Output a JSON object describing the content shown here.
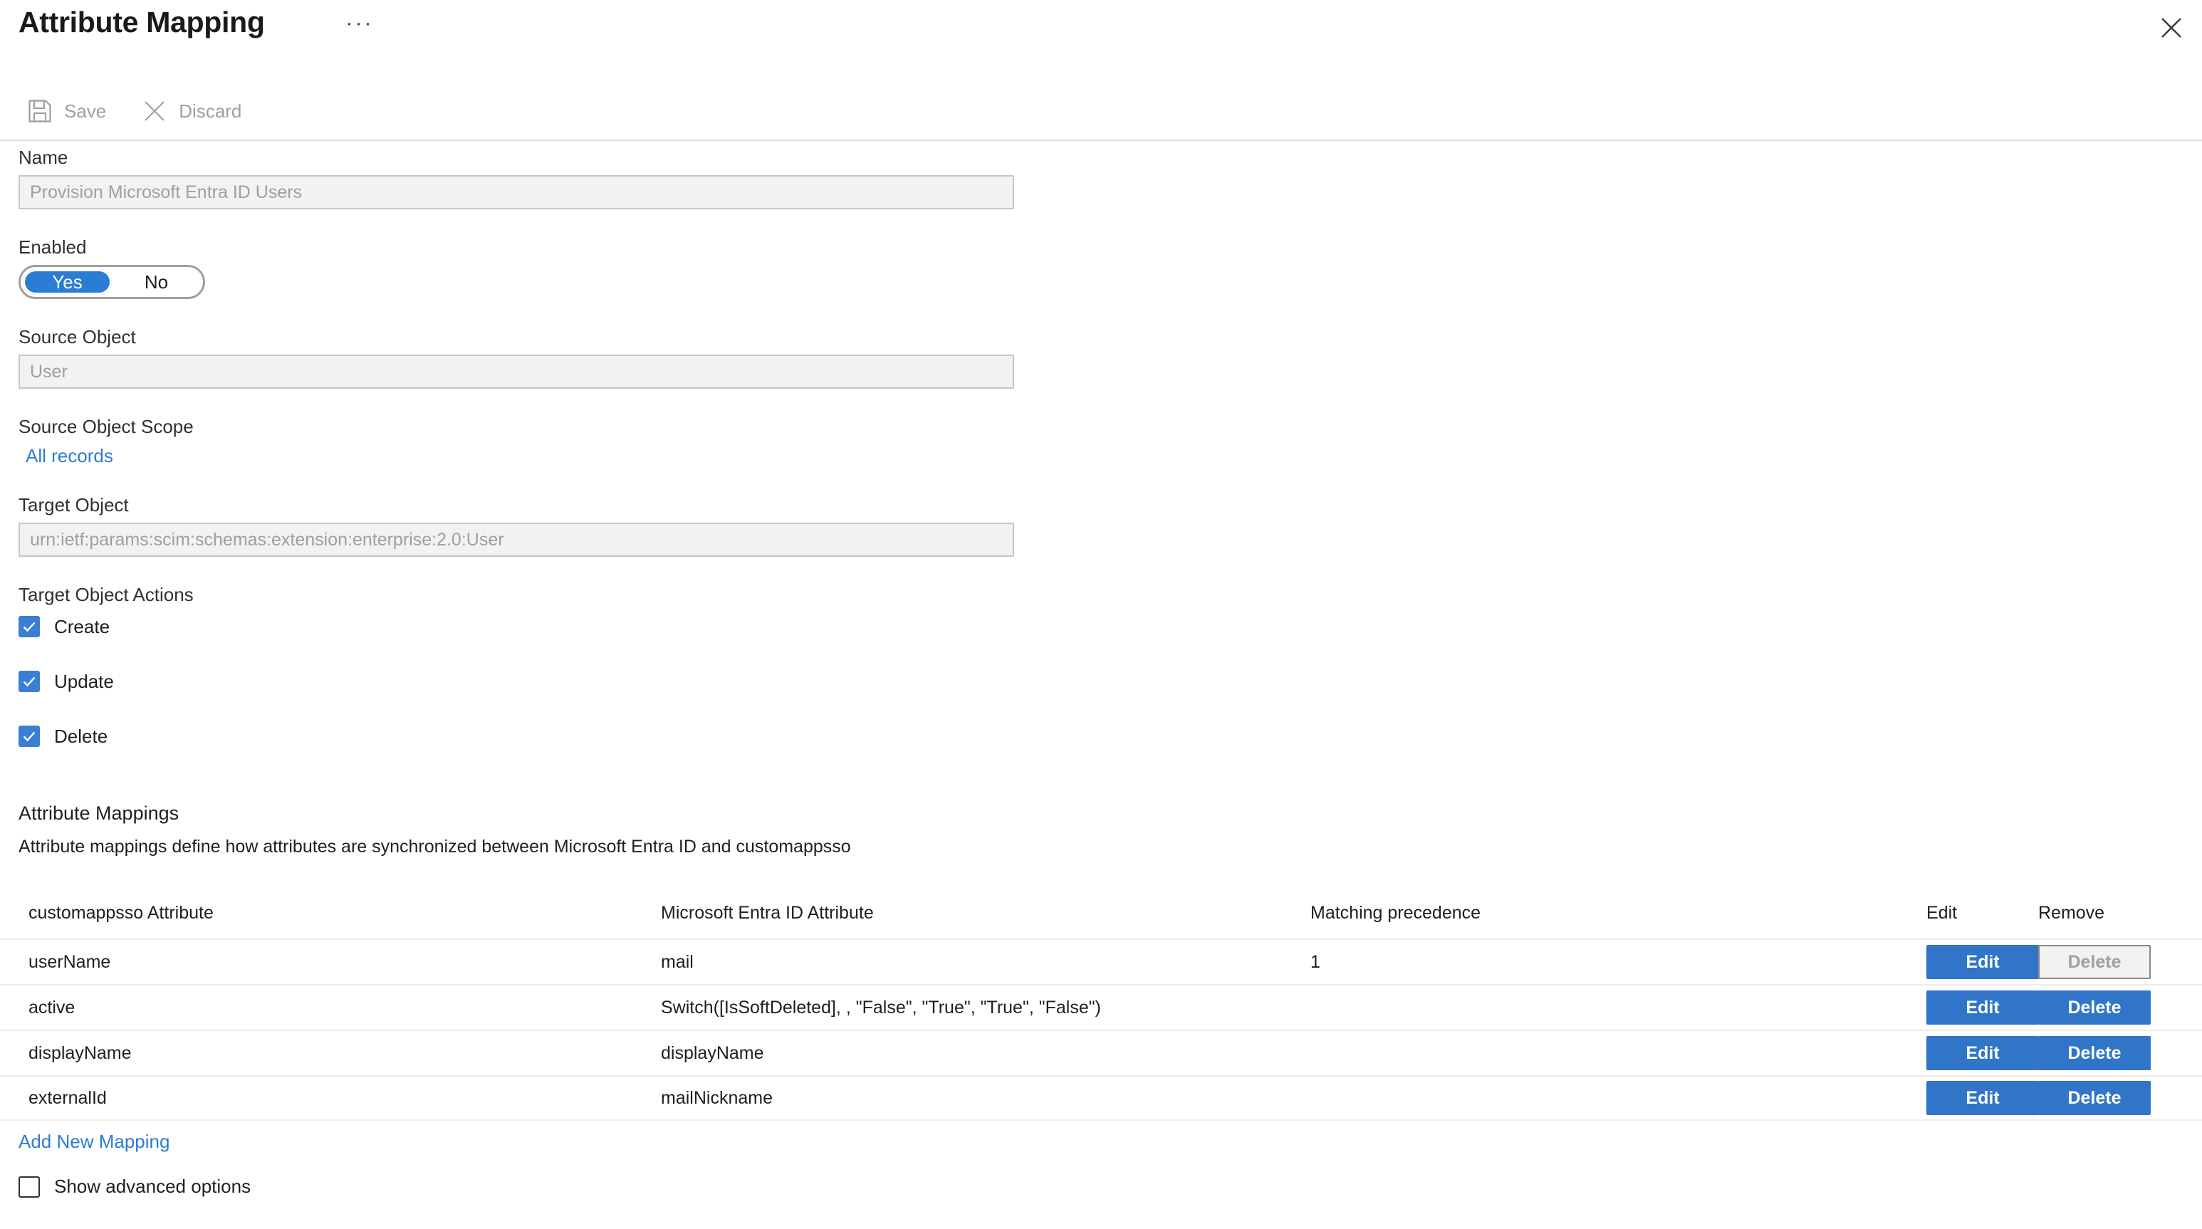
{
  "header": {
    "title": "Attribute Mapping",
    "ellipsis_label": "···",
    "close_label": "Close"
  },
  "command_bar": {
    "save_label": "Save",
    "discard_label": "Discard"
  },
  "form": {
    "name": {
      "label": "Name",
      "value": "Provision Microsoft Entra ID Users"
    },
    "enabled": {
      "label": "Enabled",
      "yes_label": "Yes",
      "no_label": "No",
      "selected": "Yes"
    },
    "source_object": {
      "label": "Source Object",
      "value": "User"
    },
    "source_object_scope": {
      "label": "Source Object Scope",
      "link_text": "All records"
    },
    "target_object": {
      "label": "Target Object",
      "value": "urn:ietf:params:scim:schemas:extension:enterprise:2.0:User"
    },
    "target_object_actions": {
      "label": "Target Object Actions",
      "items": [
        {
          "label": "Create",
          "checked": true
        },
        {
          "label": "Update",
          "checked": true
        },
        {
          "label": "Delete",
          "checked": true
        }
      ]
    }
  },
  "attribute_mappings": {
    "title": "Attribute Mappings",
    "description": "Attribute mappings define how attributes are synchronized between Microsoft Entra ID and customappsso",
    "columns": [
      "customappsso Attribute",
      "Microsoft Entra ID Attribute",
      "Matching precedence",
      "Edit",
      "Remove"
    ],
    "rows": [
      {
        "attribute": "userName",
        "entra_attribute": "mail",
        "precedence": "1",
        "edit_label": "Edit",
        "delete_label": "Delete",
        "delete_disabled": true
      },
      {
        "attribute": "active",
        "entra_attribute": "Switch([IsSoftDeleted], , \"False\", \"True\", \"True\", \"False\")",
        "precedence": "",
        "edit_label": "Edit",
        "delete_label": "Delete",
        "delete_disabled": false
      },
      {
        "attribute": "displayName",
        "entra_attribute": "displayName",
        "precedence": "",
        "edit_label": "Edit",
        "delete_label": "Delete",
        "delete_disabled": false
      },
      {
        "attribute": "externalId",
        "entra_attribute": "mailNickname",
        "precedence": "",
        "edit_label": "Edit",
        "delete_label": "Delete",
        "delete_disabled": false
      }
    ],
    "add_new_label": "Add New Mapping"
  },
  "footer": {
    "show_advanced": {
      "label": "Show advanced options",
      "checked": false
    }
  },
  "colors": {
    "accent_blue": "#2b7cd3",
    "button_blue": "#3075c8",
    "checkbox_blue": "#3b7fd4",
    "divider": "#e1dfdd",
    "row_divider": "#edebe9",
    "input_bg": "#f3f2f1",
    "disabled_text": "#a19f9d"
  }
}
